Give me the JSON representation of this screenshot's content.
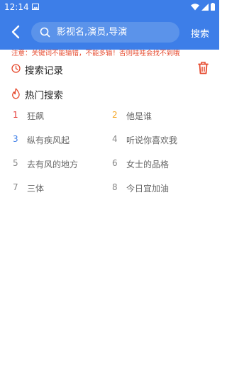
{
  "statusbar": {
    "time": "12:14"
  },
  "header": {
    "search_placeholder": "影视名,演员,导演",
    "search_button": "搜索"
  },
  "notice": "注意：关键词不能输错，不能多输！否则哇哇会找不到哦",
  "history": {
    "title": "搜索记录"
  },
  "hot": {
    "title": "热门搜索",
    "items": [
      {
        "rank": "1",
        "name": "狂飙",
        "rank_color": "#e53935"
      },
      {
        "rank": "2",
        "name": "他是谁",
        "rank_color": "#f5a623"
      },
      {
        "rank": "3",
        "name": "纵有疾风起",
        "rank_color": "#3d7ee8"
      },
      {
        "rank": "4",
        "name": "听说你喜欢我",
        "rank_color": "#888888"
      },
      {
        "rank": "5",
        "name": "去有风的地方",
        "rank_color": "#888888"
      },
      {
        "rank": "6",
        "name": "女士的品格",
        "rank_color": "#888888"
      },
      {
        "rank": "7",
        "name": "三体",
        "rank_color": "#888888"
      },
      {
        "rank": "8",
        "name": "今日宜加油",
        "rank_color": "#888888"
      }
    ]
  },
  "colors": {
    "accent": "#3d7ee8",
    "warning": "#e64a2e"
  }
}
